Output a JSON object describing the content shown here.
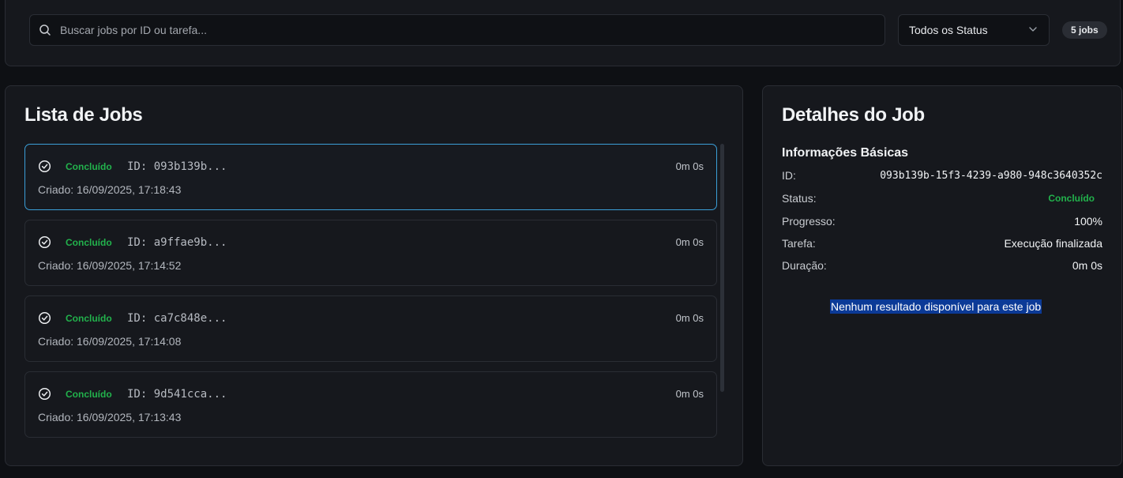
{
  "filter": {
    "search_placeholder": "Buscar jobs por ID ou tarefa...",
    "status_select": "Todos os Status",
    "jobs_count": "5 jobs"
  },
  "jobs_list": {
    "title": "Lista de Jobs",
    "items": [
      {
        "status": "Concluído",
        "id": "ID: 093b139b...",
        "duration": "0m 0s",
        "created": "Criado: 16/09/2025, 17:18:43",
        "selected": true
      },
      {
        "status": "Concluído",
        "id": "ID: a9ffae9b...",
        "duration": "0m 0s",
        "created": "Criado: 16/09/2025, 17:14:52",
        "selected": false
      },
      {
        "status": "Concluído",
        "id": "ID: ca7c848e...",
        "duration": "0m 0s",
        "created": "Criado: 16/09/2025, 17:14:08",
        "selected": false
      },
      {
        "status": "Concluído",
        "id": "ID: 9d541cca...",
        "duration": "0m 0s",
        "created": "Criado: 16/09/2025, 17:13:43",
        "selected": false
      }
    ]
  },
  "details": {
    "title": "Detalhes do Job",
    "section": "Informações Básicas",
    "rows": [
      {
        "label": "ID:",
        "value": "093b139b-15f3-4239-a980-948c3640352c"
      },
      {
        "label": "Status:",
        "value": "Concluído"
      },
      {
        "label": "Progresso:",
        "value": "100%"
      },
      {
        "label": "Tarefa:",
        "value": "Execução finalizada"
      },
      {
        "label": "Duração:",
        "value": "0m 0s"
      }
    ],
    "no_result": "Nenhum resultado disponível para este job"
  },
  "colors": {
    "accent_border": "#3b9fd8",
    "success": "#22b24c",
    "selection": "#0b3a97"
  }
}
